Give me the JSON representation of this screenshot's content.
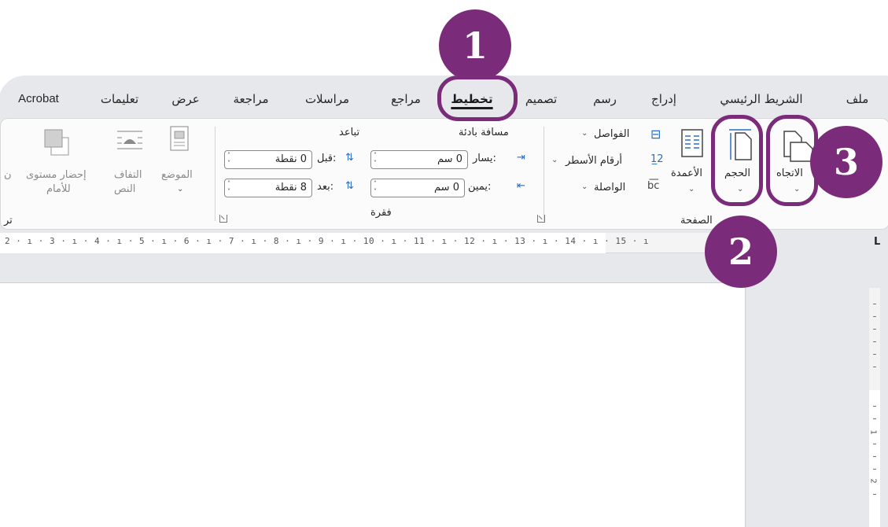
{
  "menu": {
    "tabs": [
      "ملف",
      "الشريط الرئيسي",
      "إدراج",
      "رسم",
      "تصميم",
      "تخطيط",
      "مراجع",
      "مراسلات",
      "مراجعة",
      "عرض",
      "تعليمات",
      "Acrobat"
    ],
    "active_tab": "تخطيط"
  },
  "ribbon": {
    "page_setup": {
      "orientation_label": "الاتجاه",
      "size_label": "الحجم",
      "columns_label": "الأعمدة",
      "breaks_label": "الفواصل",
      "line_numbers_label": "أرقام الأسطر",
      "hyphenation_label": "الواصلة",
      "group_label": "الصفحة"
    },
    "paragraph": {
      "indent_header": "مسافة بادئة",
      "spacing_header": "تباعد",
      "left_label": "يسار:",
      "right_label": "يمين:",
      "before_label": "قبل:",
      "after_label": "بعد:",
      "left_value": "0 سم",
      "right_value": "0 سم",
      "before_value": "0 نقطة",
      "after_value": "8 نقطة",
      "group_label": "فقرة"
    },
    "arrange": {
      "position_label": "الموضع",
      "wrap_label_1": "التفاف",
      "wrap_label_2": "النص",
      "bring_forward_1": "إحضار مستوى",
      "bring_forward_2": "للأمام",
      "cut_label": "ن",
      "group_label": "تر"
    }
  },
  "ruler": {
    "text": "2 · ı · 3 · ı · 4 · ı · 5 · ı · 6 · ı · 7 · ı · 8 · ı · 9 · ı · 10 · ı · 11 · ı · 12 · ı · 13 · ı · 14 · ı · 15 · ı",
    "corner_glyph": "L",
    "vertical_labels": [
      "1",
      "2"
    ]
  },
  "annotations": {
    "badge_1": "1",
    "badge_2": "2",
    "badge_3": "3",
    "accent_color": "#7a2b79"
  }
}
